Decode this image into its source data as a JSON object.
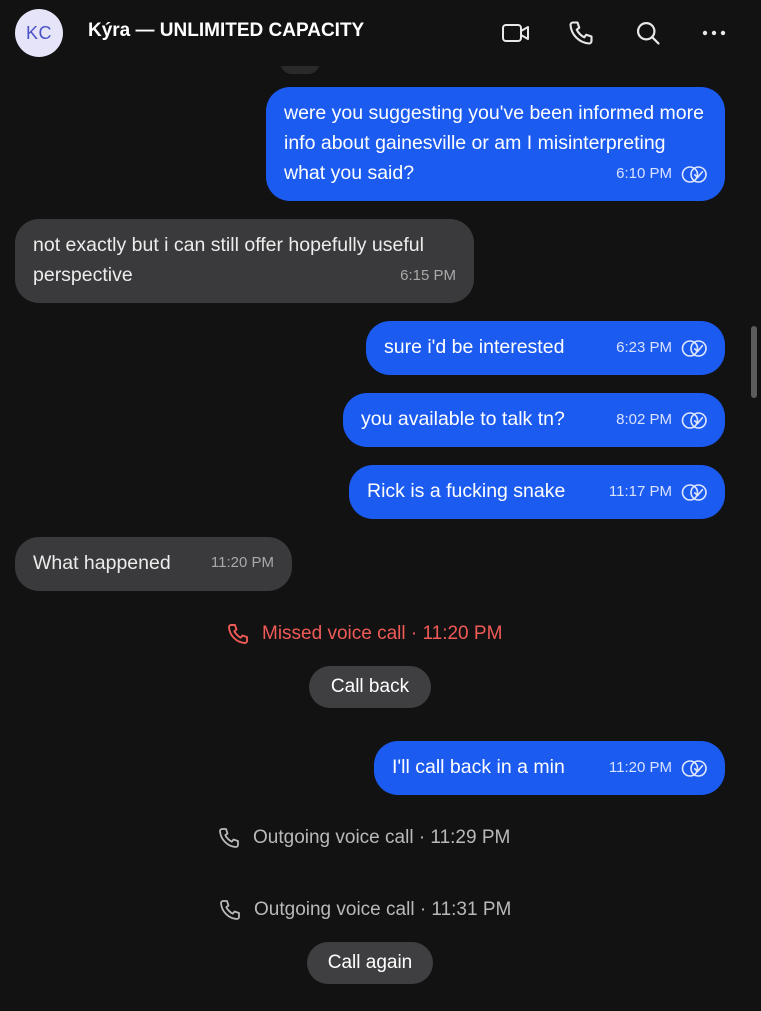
{
  "header": {
    "avatar_initials": "KC",
    "title": "Kýra — UNLIMITED CAPACITY",
    "actions": {
      "video_icon": "video-camera-icon",
      "call_icon": "phone-icon",
      "search_icon": "search-icon",
      "more_icon": "more-dots-icon"
    }
  },
  "messages": [
    {
      "direction": "outgoing",
      "text": "were you suggesting you've been informed more info about gainesville or am I misinterpreting what you said?",
      "time": "6:10 PM",
      "status_icon": "read-receipt-icon"
    },
    {
      "direction": "incoming",
      "text": "not exactly but i can still offer hopefully useful perspective",
      "time": "6:15 PM"
    },
    {
      "direction": "outgoing",
      "text": "sure i'd be interested",
      "time": "6:23 PM",
      "status_icon": "read-receipt-icon"
    },
    {
      "direction": "outgoing",
      "text": "you available to talk tn?",
      "time": "8:02 PM",
      "status_icon": "read-receipt-icon"
    },
    {
      "direction": "outgoing",
      "text": "Rick is a fucking snake",
      "time": "11:17 PM",
      "status_icon": "read-receipt-icon"
    },
    {
      "direction": "incoming",
      "text": "What happened",
      "time": "11:20 PM"
    },
    {
      "direction": "outgoing",
      "text": "I'll call back in a min",
      "time": "11:20 PM",
      "status_icon": "read-receipt-icon"
    }
  ],
  "calls": {
    "missed": {
      "label": "Missed voice call · 11:20 PM",
      "icon": "missed-call-icon",
      "button": "Call back"
    },
    "outgoing_1": {
      "label": "Outgoing voice call · 11:29 PM",
      "icon": "outgoing-call-icon"
    },
    "outgoing_2": {
      "label": "Outgoing voice call · 11:31 PM",
      "icon": "outgoing-call-icon",
      "button": "Call again"
    }
  },
  "colors": {
    "background": "#121212",
    "outgoing_bubble": "#1b5bf0",
    "incoming_bubble": "#3a3a3c",
    "missed_call": "#f05a57",
    "avatar_bg": "#e6e4f8",
    "avatar_text": "#4a52c7"
  }
}
